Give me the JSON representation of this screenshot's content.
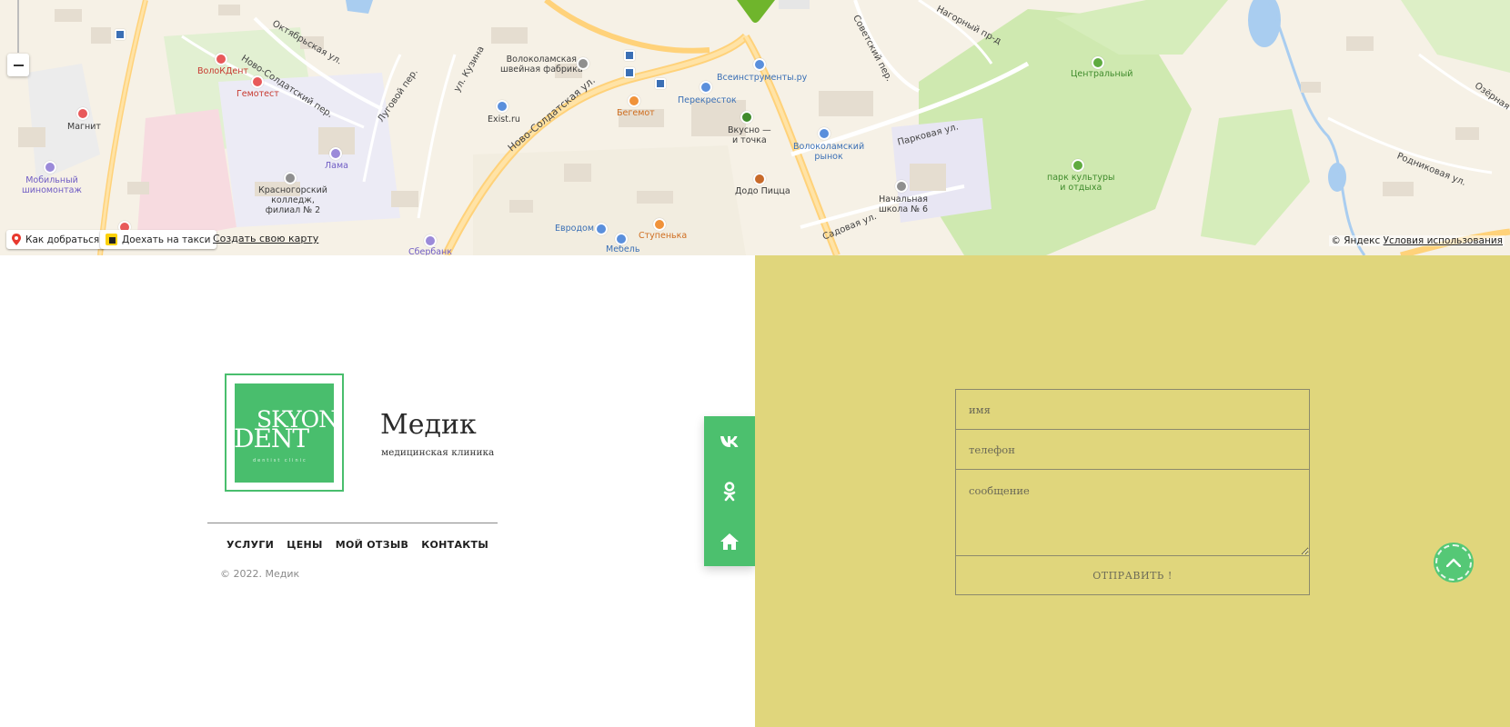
{
  "map": {
    "labels": {
      "volokdent": "ВолоКДент",
      "gemotest": "Гемотест",
      "magnit": "Магнит",
      "mobilny": "Мобильный\nшиномонтаж",
      "lama": "Лама",
      "krasnogorsky": "Красногорский\nколледж,\nфилиал № 2",
      "shveinaya": "Волоколамская\nшвейная фабрика",
      "exist": "Exist.ru",
      "begemot": "Бегемот",
      "perekrestok": "Перекресток",
      "vseinstrumenty": "Всеинструменты.ру",
      "vkusno": "Вкусно —\nи точка",
      "rynok": "Волоколамский\nрынок",
      "dodo": "Додо Пицца",
      "evrodom": "Евродом",
      "stupenka": "Ступенька",
      "mebel": "Мебель",
      "sberbank": "Сбербанк",
      "shkola": "Начальная\nшкола № 6",
      "centralny": "Центральный",
      "park": "парк культуры\nи отдыха"
    },
    "roads": {
      "novosoldatskaya": "Ново-Солдатская ул.",
      "novosoldatsky_per": "Ново-Солдатский пер.",
      "oktyabrskaya": "Октябрьская ул.",
      "lugovoy": "Луговой пер.",
      "kuzina": "ул. Кузина",
      "parkovaya": "Парковая ул.",
      "sadovaya": "Садовая ул.",
      "sovetsky": "Советский пер.",
      "nagorny": "Нагорный пр-д",
      "rodnikovaya": "Родниковая ул.",
      "ozernaya": "Озёрная"
    },
    "buttons": {
      "directions": "Как добраться",
      "taxi": "Доехать на такси",
      "create_map": "Создать свою карту"
    },
    "copyright": "© Яндекс",
    "terms": "Условия использования"
  },
  "footer": {
    "logo": {
      "line1": "SKYON",
      "line2": "DENT",
      "tagline": "dentist clinic"
    },
    "title": "Медик",
    "subtitle": "медицинская клиника",
    "nav": [
      "УСЛУГИ",
      "ЦЕНЫ",
      "МОЙ ОТЗЫВ",
      "КОНТАКТЫ"
    ],
    "copyright": "© 2022. Медик"
  },
  "social": {
    "icons": [
      "vk-icon",
      "odnoklassniki-icon",
      "home-icon"
    ]
  },
  "form": {
    "name_placeholder": "имя",
    "phone_placeholder": "телефон",
    "message_placeholder": "сообщение",
    "submit_label": "ОТПРАВИТЬ !"
  },
  "colors": {
    "brand_green": "#4cc06e",
    "form_bg": "#e0d67c"
  }
}
